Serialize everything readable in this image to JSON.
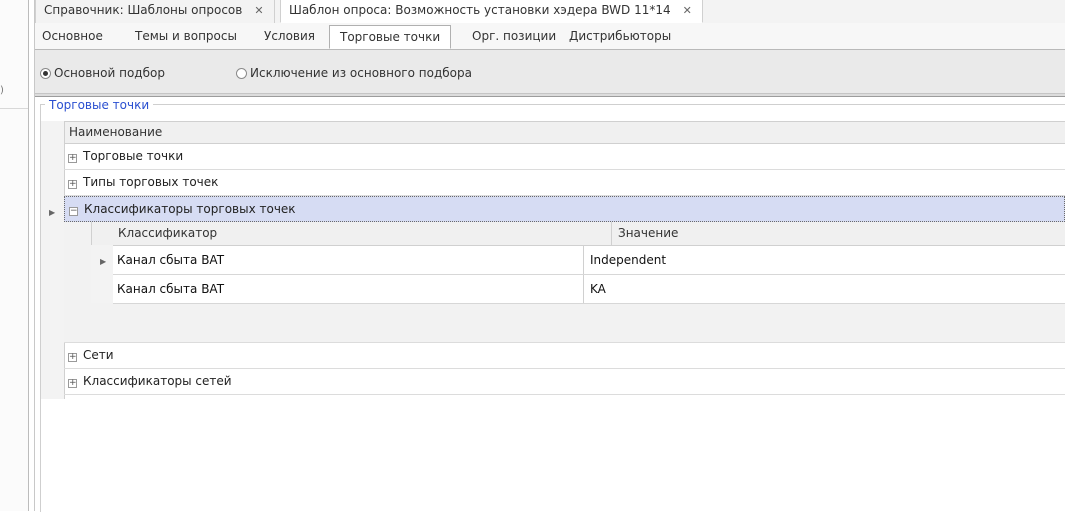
{
  "doc_tabs": [
    {
      "label": "Справочник: Шаблоны опросов",
      "close": "✕"
    },
    {
      "label": "Шаблон опроса: Возможность установки хэдера BWD 11*14",
      "close": "✕"
    }
  ],
  "sub_tabs": [
    "Основное",
    "Темы и вопросы",
    "Условия",
    "Торговые точки",
    "Орг. позиции",
    "Дистрибьюторы"
  ],
  "radios": {
    "option1": "Основной подбор",
    "option2": "Исключение из основного подбора",
    "selected": "option1"
  },
  "group_title": "Торговые точки",
  "grid": {
    "header": "Наименование",
    "rows": [
      {
        "label": "Торговые точки",
        "expander": "+"
      },
      {
        "label": "Типы торговых точек",
        "expander": "+"
      },
      {
        "label": "Классификаторы торговых точек",
        "expander": "−"
      },
      {
        "label": "Сети",
        "expander": "+"
      },
      {
        "label": "Классификаторы сетей",
        "expander": "+"
      }
    ],
    "detail": {
      "col1": "Классификатор",
      "col2": "Значение",
      "rows": [
        {
          "c1": "Канал сбыта BAT",
          "c2": "Independent"
        },
        {
          "c1": "Канал сбыта BAT",
          "c2": "KA"
        }
      ]
    }
  }
}
